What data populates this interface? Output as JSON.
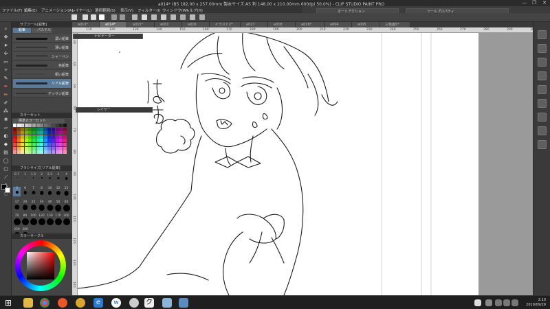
{
  "window": {
    "title": "a014* (B5 182.00 x 257.00mm 製本サイズ:A5 判 148.00 x 210.00mm 600dpi 50.0%) - CLIP STUDIO PAINT PRO",
    "minimize": "—",
    "maximize": "❐",
    "close": "✕"
  },
  "menu": [
    "ファイル(F)",
    "編集(E)",
    "アニメーション(A)",
    "レイヤー(L)",
    "選択範囲(S)",
    "表示(V)",
    "フィルター(I)",
    "ウィンドウ(W)",
    "ヘルプ(H)"
  ],
  "right_panels": {
    "auto_action": "オートアクション",
    "tool_property": "ツールプロパティ"
  },
  "tabs": [
    "a013*",
    "a014*",
    "a015*",
    "a001",
    "a016",
    "イラスト2*",
    "a017",
    "a018",
    "a019*",
    "a004",
    "a005",
    "三色画5*"
  ],
  "active_tab_index": 1,
  "subtool_panel": {
    "header": "サブツール[鉛筆]",
    "tabs": [
      "鉛筆",
      "パステル"
    ],
    "brushes": [
      "濃い鉛筆",
      "薄い鉛筆",
      "シャーペン",
      "色鉛筆",
      "粗い鉛筆",
      "リアル鉛筆",
      "デッサン鉛筆"
    ],
    "selected_index": 5
  },
  "color_set_panel": {
    "header": "カラーセット",
    "set_name": "標準カラーセット"
  },
  "brush_size_panel": {
    "header": "ブラシサイズ[リアル鉛筆]",
    "sizes": [
      "0.7",
      "1",
      "1.5",
      "2",
      "2.5",
      "3",
      "4",
      "5",
      "6",
      "7",
      "8",
      "10",
      "12",
      "15",
      "17",
      "20",
      "25",
      "30",
      "40",
      "50",
      "60",
      "70",
      "80",
      "100",
      "120",
      "150",
      "170",
      "200",
      "250",
      "300"
    ]
  },
  "color_wheel_header": "カラーサークル",
  "navigator": "ナビゲーター",
  "layer_panel": "レイヤー",
  "ruler_top_ticks": [
    "110",
    "120",
    "130",
    "140",
    "150",
    "160",
    "170",
    "180",
    "190",
    "200",
    "210",
    "220",
    "230",
    "240",
    "250",
    "260",
    "270",
    "280",
    "290",
    "300"
  ],
  "ruler_left_ticks": [
    "30",
    "40",
    "50",
    "60",
    "70",
    "80",
    "90",
    "100",
    "110",
    "120",
    "130",
    "140"
  ],
  "canvas_text": "はぁ",
  "clock": {
    "time": "2:10",
    "date": "2019/09/29"
  },
  "colors": {
    "app_bg": "#3c3c3c",
    "canvas": "#ffffff",
    "selected_brush": "#5a7a9a",
    "taskbar": "#1f1f1f"
  }
}
